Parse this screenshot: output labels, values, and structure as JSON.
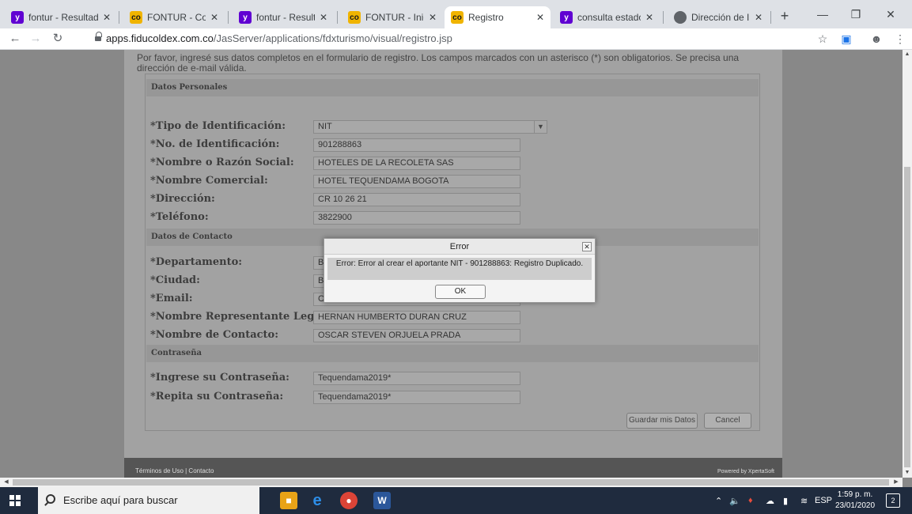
{
  "browser": {
    "tabs": [
      {
        "label": "fontur - Resultado",
        "icon": "yahoo-icon"
      },
      {
        "label": "FONTUR - Contact",
        "icon": "fontur-icon"
      },
      {
        "label": "fontur - Resultado",
        "icon": "yahoo-icon"
      },
      {
        "label": "FONTUR - Inicio",
        "icon": "fontur-icon"
      },
      {
        "label": "Registro",
        "icon": "fontur-icon",
        "active": true
      },
      {
        "label": "consulta estado ru",
        "icon": "yahoo-icon"
      },
      {
        "label": "Dirección de Impu",
        "icon": "globe-icon"
      }
    ],
    "tab_close_glyph": "✕",
    "new_tab_glyph": "+",
    "url_host": "apps.fiducoldex.com.co",
    "url_path": "/JasServer/applications/fdxturismo/visual/registro.jsp"
  },
  "intro": "Por favor, ingresé sus datos completos en el formulario de registro. Los campos marcados con un asterisco (*) son obligatorios. Se precisa una dirección de e-mail válida.",
  "sections": {
    "personal": "Datos Personales",
    "contact": "Datos de Contacto",
    "password": "Contraseña"
  },
  "fields": {
    "tipo_id": {
      "label": "*Tipo de Identificación:",
      "value": "NIT"
    },
    "no_id": {
      "label": "*No. de Identificación:",
      "value": "901288863"
    },
    "razon_social": {
      "label": "*Nombre o Razón Social:",
      "value": "HOTELES DE LA RECOLETA SAS"
    },
    "nombre_comercial": {
      "label": "*Nombre Comercial:",
      "value": "HOTEL TEQUENDAMA BOGOTA"
    },
    "direccion": {
      "label": "*Dirección:",
      "value": "CR 10 26 21"
    },
    "telefono": {
      "label": "*Teléfono:",
      "value": "3822900"
    },
    "departamento": {
      "label": "*Departamento:",
      "value": "B"
    },
    "ciudad": {
      "label": "*Ciudad:",
      "value": "B"
    },
    "email": {
      "label": "*Email:",
      "value": "C"
    },
    "representante": {
      "label": "*Nombre Representante Legal:",
      "value": "HERNAN HUMBERTO DURAN CRUZ"
    },
    "contacto": {
      "label": "*Nombre de Contacto:",
      "value": "OSCAR STEVEN ORJUELA PRADA"
    },
    "password": {
      "label": "*Ingrese su Contraseña:",
      "value": "Tequendama2019*"
    },
    "password_repeat": {
      "label": "*Repita su Contraseña:",
      "value": "Tequendama2019*"
    }
  },
  "buttons": {
    "save": "Guardar mis Datos",
    "cancel": "Cancel"
  },
  "footer": {
    "links": "Términos de Uso | Contacto",
    "powered": "Powered by XpertaSoft"
  },
  "dialog": {
    "title": "Error",
    "message": "Error: Error al crear el aportante NIT - 901288863: Registro Duplicado.",
    "ok": "OK"
  },
  "taskbar": {
    "search_placeholder": "Escribe aquí para buscar",
    "language": "ESP",
    "time": "1:59 p. m.",
    "date": "23/01/2020",
    "notifications": "2"
  }
}
